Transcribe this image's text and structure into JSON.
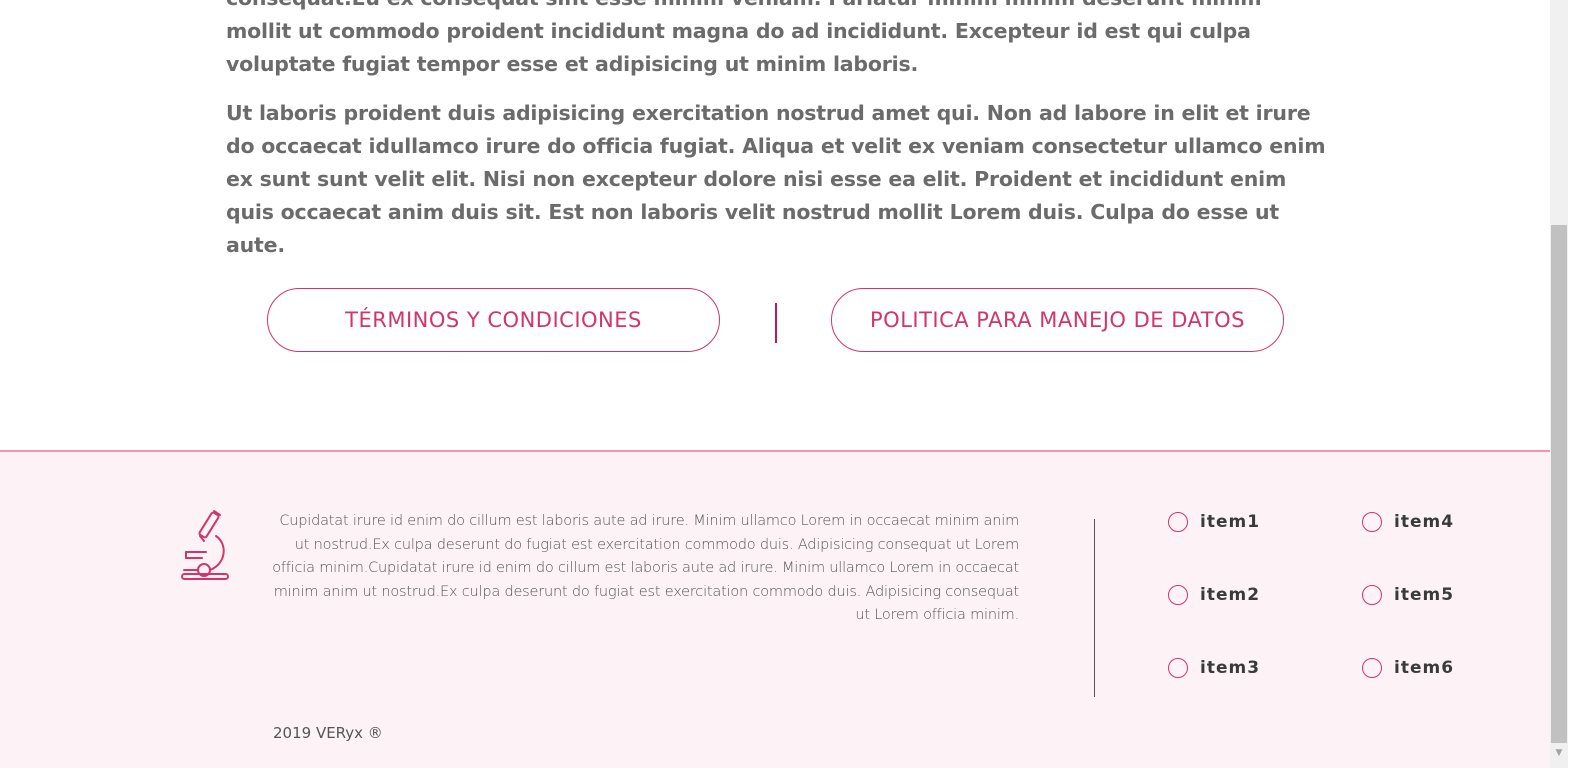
{
  "article": {
    "paragraphs": [
      "consequat.Eu ex consequat sint esse minim veniam. Pariatur minim minim deserunt minim mollit ut commodo proident incididunt magna do ad incididunt. Excepteur id est qui culpa voluptate fugiat tempor esse et adipisicing ut minim laboris.",
      "Ut laboris proident duis adipisicing exercitation nostrud amet qui. Non ad labore in elit et irure do occaecat idullamco irure do officia fugiat. Aliqua et velit ex veniam consectetur ullamco enim ex sunt sunt velit elit. Nisi non excepteur dolore nisi esse ea elit. Proident et incididunt enim quis occaecat anim duis sit. Est non laboris velit nostrud mollit Lorem duis. Culpa do esse ut aute."
    ]
  },
  "legal": {
    "terms_label": "TÉRMINOS Y CONDICIONES",
    "policy_label": "POLITICA PARA MANEJO DE DATOS"
  },
  "footer": {
    "logo_icon": "microscope-icon",
    "description": "Cupidatat irure id enim do cillum est laboris aute ad irure. Minim ullamco Lorem in occaecat minim anim ut nostrud.Ex culpa deserunt do fugiat est exercitation commodo duis. Adipisicing consequat ut Lorem officia minim.Cupidatat irure id enim do cillum est laboris aute ad irure. Minim ullamco Lorem in occaecat minim anim ut nostrud.Ex culpa deserunt do fugiat est exercitation commodo duis. Adipisicing consequat ut Lorem officia minim.",
    "items": [
      {
        "label": "item1"
      },
      {
        "label": "item2"
      },
      {
        "label": "item3"
      },
      {
        "label": "item4"
      },
      {
        "label": "item5"
      },
      {
        "label": "item6"
      }
    ],
    "copyright": "2019 VERyx ®"
  },
  "colors": {
    "accent": "#d1356b",
    "footer_bg": "#fdf3f6",
    "footer_border": "#f493b4",
    "text": "#6b6b6b"
  }
}
